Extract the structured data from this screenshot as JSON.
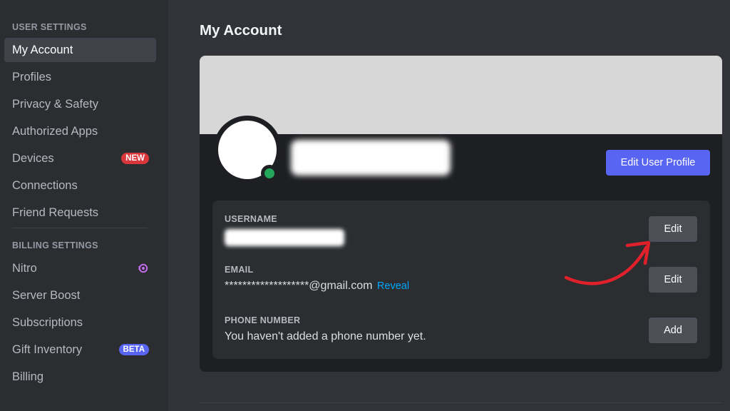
{
  "sidebar": {
    "user_settings_header": "USER SETTINGS",
    "user_items": [
      {
        "label": "My Account"
      },
      {
        "label": "Profiles"
      },
      {
        "label": "Privacy & Safety"
      },
      {
        "label": "Authorized Apps"
      },
      {
        "label": "Devices",
        "badge": "NEW"
      },
      {
        "label": "Connections"
      },
      {
        "label": "Friend Requests"
      }
    ],
    "billing_settings_header": "BILLING SETTINGS",
    "billing_items": [
      {
        "label": "Nitro",
        "icon": "nitro-icon"
      },
      {
        "label": "Server Boost"
      },
      {
        "label": "Subscriptions"
      },
      {
        "label": "Gift Inventory",
        "badge": "BETA"
      },
      {
        "label": "Billing"
      }
    ]
  },
  "main": {
    "title": "My Account",
    "edit_profile_label": "Edit User Profile",
    "fields": {
      "username": {
        "label": "USERNAME",
        "button": "Edit"
      },
      "email": {
        "label": "EMAIL",
        "value": "*******************@gmail.com",
        "reveal": "Reveal",
        "button": "Edit"
      },
      "phone": {
        "label": "PHONE NUMBER",
        "value": "You haven't added a phone number yet.",
        "button": "Add"
      }
    }
  },
  "colors": {
    "accent": "#5865f2",
    "status_online": "#23a55a",
    "badge_new": "#da373c",
    "link": "#00a8fc",
    "arrow": "#e0202a"
  }
}
